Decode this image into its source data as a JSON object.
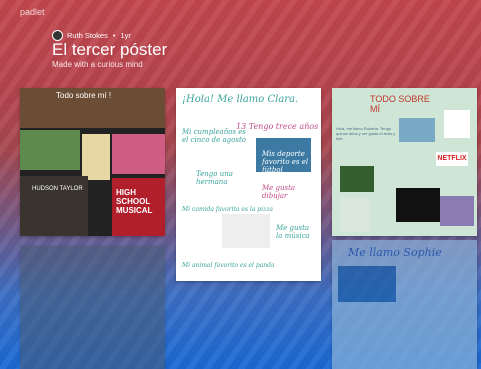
{
  "app": {
    "logo": "padlet"
  },
  "board": {
    "author": "Ruth Stokes",
    "age": "1yr",
    "title": "El tercer póster",
    "subtitle": "Made with a curious mind"
  },
  "posts": {
    "p1": {
      "header": "Todo sobre mí !",
      "tiles": [
        "HIGH SCHOOL MUSICAL",
        "HUDSON TAYLOR"
      ]
    },
    "p2": {
      "header": "¡Hola! Me llamo Clara.",
      "lines": [
        "Mi cumpleaños es el cinco de agosto",
        "13 Tengo trece años",
        "Tengo una hermana",
        "Me gusta dibujar",
        "Mis deporte favorito es el fútbol",
        "Me gusta la música",
        "Mi comida favorita es la pizza",
        "Mi animal favorito es el panda"
      ]
    },
    "p3": {
      "header": "TODO SOBRE MÍ",
      "netflix": "NETFLIX"
    },
    "p4": {
      "header": "Me llamo Sophie"
    }
  }
}
